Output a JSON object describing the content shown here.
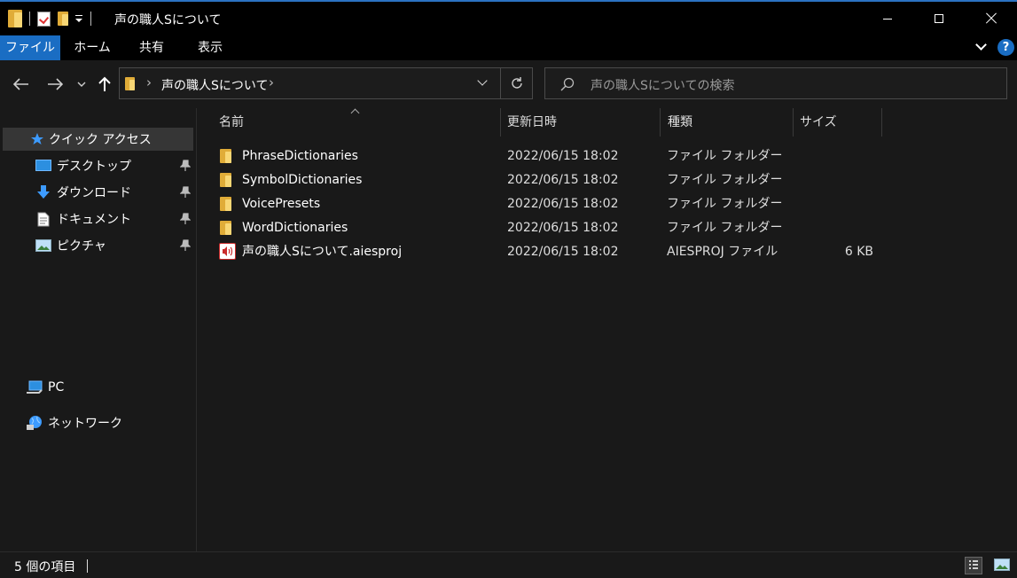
{
  "window": {
    "title": "声の職人Sについて"
  },
  "ribbon": {
    "tabs": [
      "ファイル",
      "ホーム",
      "共有",
      "表示"
    ],
    "help_label": "?"
  },
  "address": {
    "crumb": "声の職人Sについて"
  },
  "search": {
    "placeholder": "声の職人Sについての検索"
  },
  "sidebar": {
    "quick_access": "クイック アクセス",
    "items": [
      "デスクトップ",
      "ダウンロード",
      "ドキュメント",
      "ピクチャ"
    ],
    "pc": "PC",
    "network": "ネットワーク"
  },
  "columns": [
    "名前",
    "更新日時",
    "種類",
    "サイズ"
  ],
  "files": [
    {
      "name": "PhraseDictionaries",
      "modified": "2022/06/15 18:02",
      "type": "ファイル フォルダー",
      "size": "",
      "icon": "folder-icon"
    },
    {
      "name": "SymbolDictionaries",
      "modified": "2022/06/15 18:02",
      "type": "ファイル フォルダー",
      "size": "",
      "icon": "folder-icon"
    },
    {
      "name": "VoicePresets",
      "modified": "2022/06/15 18:02",
      "type": "ファイル フォルダー",
      "size": "",
      "icon": "folder-icon"
    },
    {
      "name": "WordDictionaries",
      "modified": "2022/06/15 18:02",
      "type": "ファイル フォルダー",
      "size": "",
      "icon": "folder-icon"
    },
    {
      "name": "声の職人Sについて.aiesproj",
      "modified": "2022/06/15 18:02",
      "type": "AIESPROJ ファイル",
      "size": "6 KB",
      "icon": "audio-project-icon"
    }
  ],
  "status": {
    "count_text": "5 個の項目"
  },
  "colors": {
    "accent": "#1a6dc3",
    "background": "#191919",
    "titlebar": "#000000",
    "selected": "#363636",
    "folder": "#f8d775"
  }
}
